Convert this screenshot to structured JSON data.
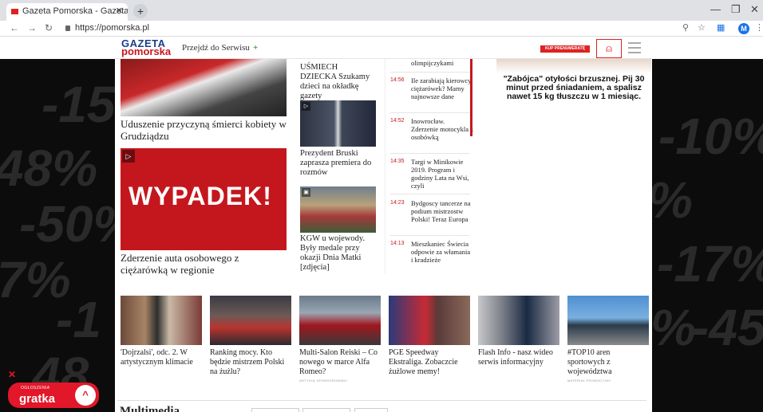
{
  "browser": {
    "tab_title": "Gazeta Pomorska - Gazeta Pomo",
    "url": "https://pomorska.pl",
    "profile_initial": "M"
  },
  "site": {
    "logo_top": "GAZETA",
    "logo_bottom": "pomorska",
    "goto_service": "Przejdź do Serwisu",
    "subscribe": "KUP PRENUMERATĘ"
  },
  "background_promo": {
    "left": [
      "-15",
      "48%",
      "-50%",
      "7%",
      "-1",
      "48"
    ],
    "right": [
      "-10%",
      "%",
      "-17%",
      "%",
      "-45"
    ]
  },
  "left_column": [
    {
      "caption": "Uduszenie przyczyną śmierci kobiety w Grudziądzu"
    },
    {
      "caption": "Zderzenie auta osobowego z ciężarówką w regionie",
      "overlay": "WYPADEK!"
    }
  ],
  "mid_column": [
    {
      "caption": "UŚMIECH DZIECKA Szukamy dzieci na okładkę gazety"
    },
    {
      "caption": "Prezydent Bruski zaprasza premiera do rozmów"
    },
    {
      "caption": "KGW u wojewody. Były medale przy okazji Dnia Matki [zdjęcia]"
    }
  ],
  "feed": [
    {
      "time": "",
      "text": "olimpijczykami"
    },
    {
      "time": "14:56",
      "text": "Ile zarabiają kierowcy ciężarówek? Mamy najnowsze dane"
    },
    {
      "time": "14:52",
      "text": "Inowrocław. Zderzenie motocykla z osobówką"
    },
    {
      "time": "14:35",
      "text": "Targi w Minikowie 2019. Program i godziny Lata na Wsi, czyli"
    },
    {
      "time": "14:23",
      "text": "Bydgoscy tancerze na podium mistrzostw Polski! Teraz Europa"
    },
    {
      "time": "14:13",
      "text": "Mieszkaniec Świecia odpowie za włamania i kradzieże"
    }
  ],
  "ad": {
    "text": "\"Zabójca\" otyłości brzusznej. Pij 30 minut przed śniadaniem, a spalisz nawet 15 kg tłuszczu w 1 miesiąc."
  },
  "tiles": [
    {
      "caption": "'Dojrzalsi', odc. 2. W artystycznym klimacie",
      "sponsor": ""
    },
    {
      "caption": "Ranking mocy. Kto będzie mistrzem Polski na żużlu?",
      "sponsor": ""
    },
    {
      "caption": "Multi-Salon Reiski – Co nowego w marce Alfa Romeo?",
      "sponsor": "ARTYKUŁ SPONSOROWANY"
    },
    {
      "caption": "PGE Speedway Ekstraliga. Zobaczcie żużlowe memy!",
      "sponsor": ""
    },
    {
      "caption": "Flash Info - nasz wideo serwis informacyjny",
      "sponsor": ""
    },
    {
      "caption": "#TOP10 aren sportowych z województwa",
      "sponsor": "MATERIAŁ PROMOCYJNY"
    }
  ],
  "multimedia_heading": "Multimedia",
  "promo": {
    "label": "OGŁOSZENIA",
    "brand": "gratka"
  }
}
